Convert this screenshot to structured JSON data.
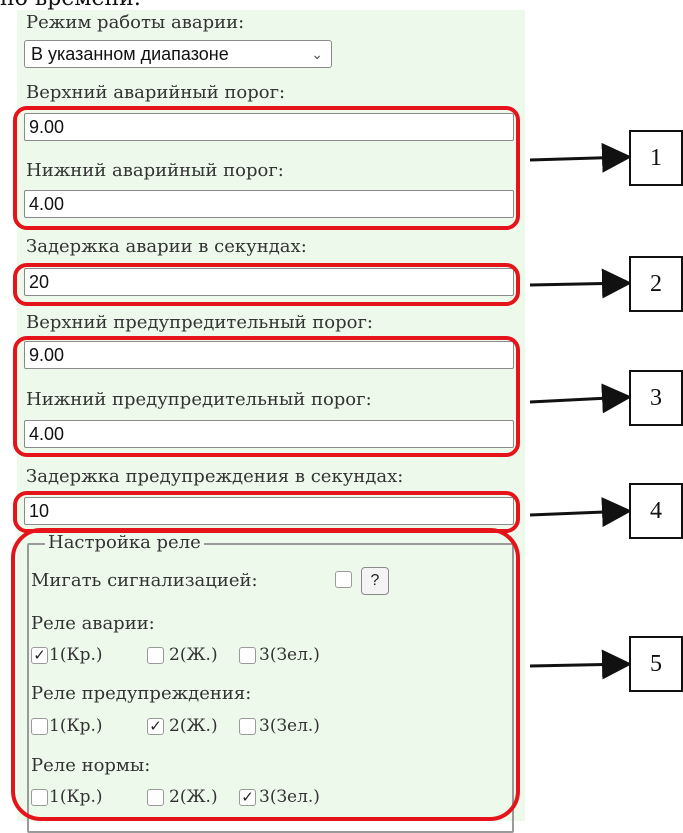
{
  "header_fragment": "но времени.",
  "alarm_mode": {
    "label": "Режим работы аварии:",
    "selected": "В указанном диапазоне"
  },
  "upper_alarm": {
    "label": "Верхний аварийный порог:",
    "value": "9.00"
  },
  "lower_alarm": {
    "label": "Нижний аварийный порог:",
    "value": "4.00"
  },
  "alarm_delay": {
    "label": "Задержка аварии в секундах:",
    "value": "20"
  },
  "upper_warning": {
    "label": "Верхний предупредительный порог:",
    "value": "9.00"
  },
  "lower_warning": {
    "label": "Нижний предупредительный порог:",
    "value": "4.00"
  },
  "warning_delay": {
    "label": "Задержка предупреждения в секундах:",
    "value": "10"
  },
  "relay": {
    "legend": "Настройка реле",
    "blink_label": "Мигать сигнализацией:",
    "help_label": "?",
    "alarm_label": "Реле аварии:",
    "warning_label": "Реле предупреждения:",
    "normal_label": "Реле нормы:",
    "opt1": "1(Кр.)",
    "opt2": "2(Ж.)",
    "opt3": "3(Зел.)",
    "check_mark": "✓"
  },
  "callouts": [
    "1",
    "2",
    "3",
    "4",
    "5"
  ],
  "colors": {
    "panel_bg": "#edfaeb",
    "highlight": "#e5141b"
  }
}
